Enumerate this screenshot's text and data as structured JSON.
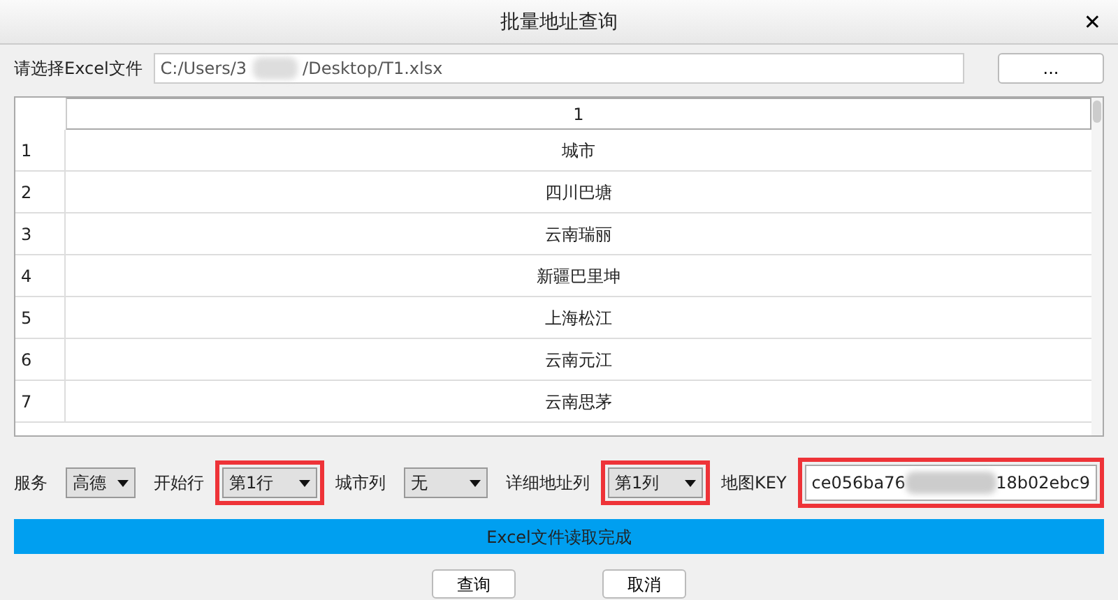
{
  "window": {
    "title": "批量地址查询",
    "close": "✕"
  },
  "file": {
    "label": "请选择Excel文件",
    "path_start": "C:/Users/3",
    "path_end": "/Desktop/T1.xlsx",
    "browse": "..."
  },
  "table": {
    "columns": [
      "1"
    ],
    "rows": [
      {
        "header": "1",
        "cells": [
          "城市"
        ]
      },
      {
        "header": "2",
        "cells": [
          "四川巴塘"
        ]
      },
      {
        "header": "3",
        "cells": [
          "云南瑞丽"
        ]
      },
      {
        "header": "4",
        "cells": [
          "新疆巴里坤"
        ]
      },
      {
        "header": "5",
        "cells": [
          "上海松江"
        ]
      },
      {
        "header": "6",
        "cells": [
          "云南元江"
        ]
      },
      {
        "header": "7",
        "cells": [
          "云南思茅"
        ]
      }
    ]
  },
  "options": [
    {
      "kind": "select",
      "label": "服务",
      "value": "高德",
      "highlighted": false
    },
    {
      "kind": "select",
      "label": "开始行",
      "value": "第1行",
      "highlighted": true
    },
    {
      "kind": "select",
      "label": "城市列",
      "value": "无",
      "highlighted": false
    },
    {
      "kind": "select",
      "label": "详细地址列",
      "value": "第1列",
      "highlighted": true
    },
    {
      "kind": "text",
      "label": "地图KEY",
      "value_start": "ce056ba76",
      "value_end": "18b02ebc9",
      "highlighted": true
    }
  ],
  "status_bar": {
    "text": "Excel文件读取完成"
  },
  "buttons": [
    "查询",
    "取消"
  ]
}
